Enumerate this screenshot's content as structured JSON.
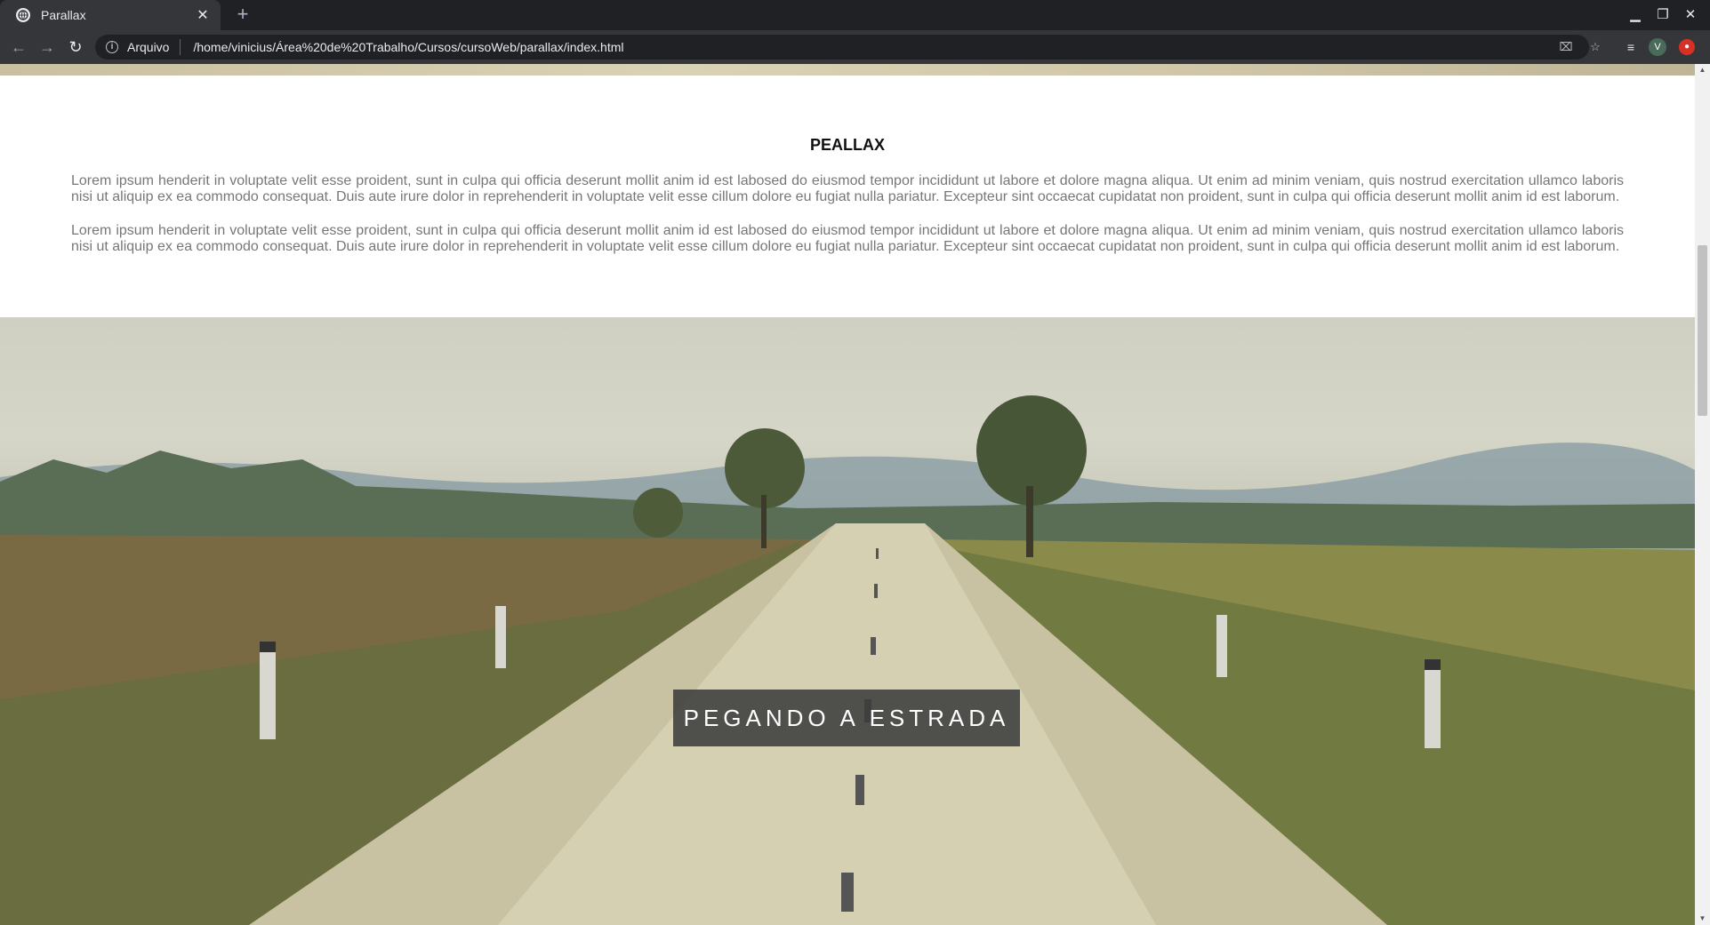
{
  "browser": {
    "tab_title": "Parallax",
    "new_tab_symbol": "+",
    "close_symbol": "✕",
    "security_label": "Arquivo",
    "url": "/home/vinicius/Área%20de%20Trabalho/Cursos/cursoWeb/parallax/index.html",
    "profile_initial": "V"
  },
  "page": {
    "heading": "PEALLAX",
    "paragraphs": [
      "Lorem ipsum henderit in voluptate velit esse proident, sunt in culpa qui officia deserunt mollit anim id est labosed do eiusmod tempor incididunt ut labore et dolore magna aliqua. Ut enim ad minim veniam, quis nostrud exercitation ullamco laboris nisi ut aliquip ex ea commodo consequat. Duis aute irure dolor in reprehenderit in voluptate velit esse cillum dolore eu fugiat nulla pariatur. Excepteur sint occaecat cupidatat non proident, sunt in culpa qui officia deserunt mollit anim id est laborum.",
      "Lorem ipsum henderit in voluptate velit esse proident, sunt in culpa qui officia deserunt mollit anim id est labosed do eiusmod tempor incididunt ut labore et dolore magna aliqua. Ut enim ad minim veniam, quis nostrud exercitation ullamco laboris nisi ut aliquip ex ea commodo consequat. Duis aute irure dolor in reprehenderit in voluptate velit esse cillum dolore eu fugiat nulla pariatur. Excepteur sint occaecat cupidatat non proident, sunt in culpa qui officia deserunt mollit anim id est laborum."
    ],
    "hero_caption": "PEGANDO A ESTRADA"
  },
  "icons": [
    "globe-icon",
    "close-icon",
    "plus-icon",
    "minimize-icon",
    "restore-icon",
    "back-icon",
    "forward-icon",
    "reload-icon",
    "info-icon",
    "translate-icon",
    "star-icon",
    "media-icon",
    "extension-icon"
  ],
  "colors": {
    "chrome_dark": "#202124",
    "chrome_tab": "#35363a",
    "caption_bg": "#3c3c3c",
    "paragraph_text": "#777777"
  }
}
